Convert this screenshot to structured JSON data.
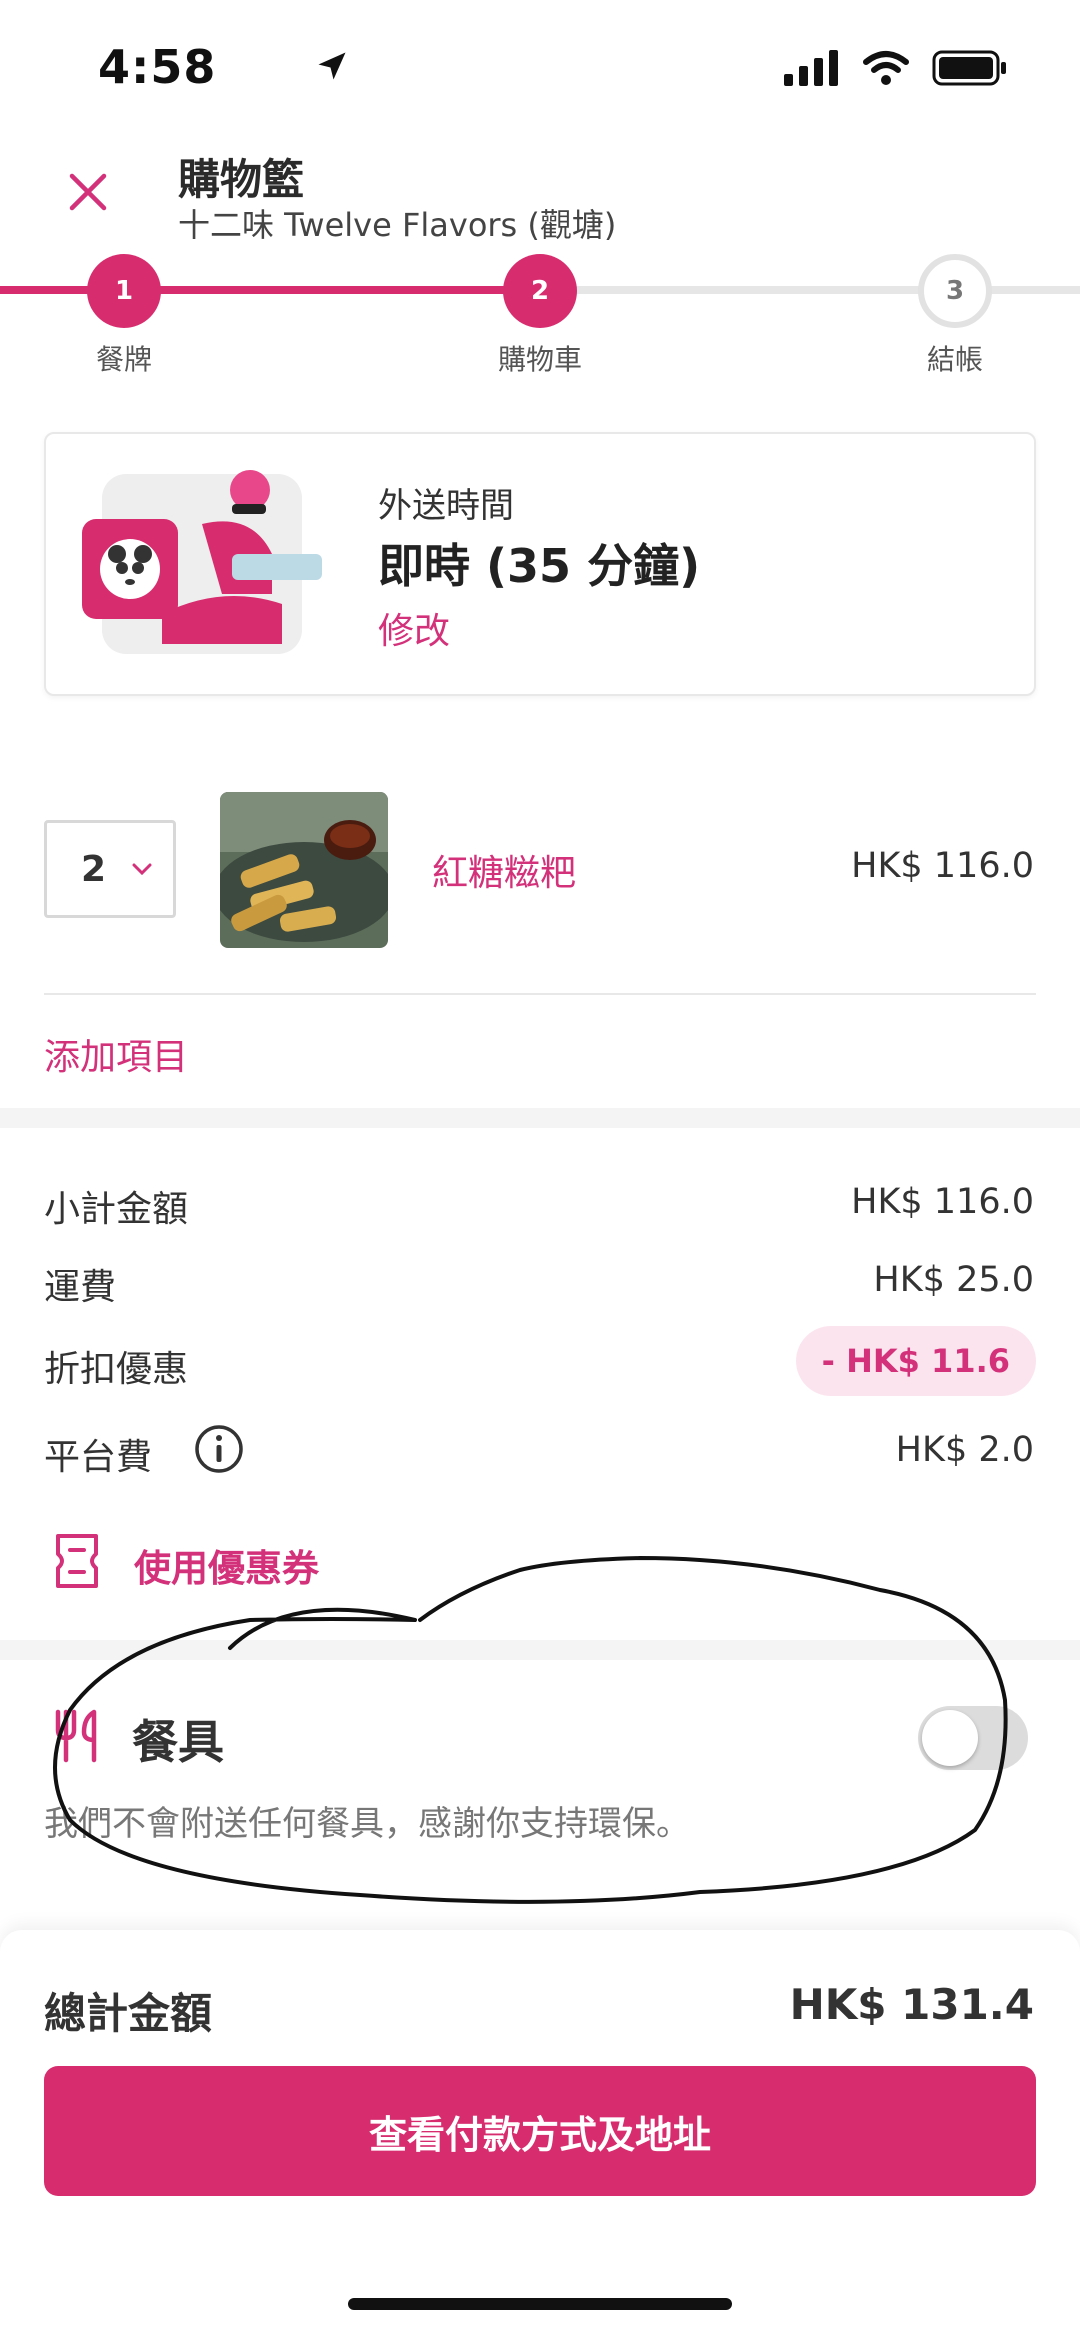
{
  "status_bar": {
    "time": "4:58"
  },
  "header": {
    "title": "購物籃",
    "restaurant": "十二味 Twelve Flavors (觀塘)"
  },
  "stepper": {
    "steps": [
      {
        "number": "1",
        "label": "餐牌",
        "state": "done"
      },
      {
        "number": "2",
        "label": "購物車",
        "state": "active"
      },
      {
        "number": "3",
        "label": "結帳",
        "state": "pending"
      }
    ]
  },
  "delivery": {
    "label": "外送時間",
    "value": "即時 (35 分鐘)",
    "edit_label": "修改"
  },
  "cart": {
    "items": [
      {
        "quantity": "2",
        "name": "紅糖糍粑",
        "price": "HK$ 116.0"
      }
    ],
    "add_item_label": "添加項目"
  },
  "summary": {
    "subtotal_label": "小計金額",
    "subtotal_value": "HK$ 116.0",
    "delivery_fee_label": "運費",
    "delivery_fee_value": "HK$ 25.0",
    "discount_label": "折扣優惠",
    "discount_value": "- HK$ 11.6",
    "platform_fee_label": "平台費",
    "platform_fee_value": "HK$ 2.0",
    "voucher_label": "使用優惠券"
  },
  "cutlery": {
    "title": "餐具",
    "description": "我們不會附送任何餐具，感謝你支持環保。",
    "enabled": false
  },
  "footer": {
    "total_label": "總計金額",
    "total_value": "HK$ 131.4",
    "cta_label": "查看付款方式及地址"
  },
  "colors": {
    "brand": "#d72d6f",
    "accent_text": "#d4317b",
    "discount_bg": "#fce4ef"
  }
}
